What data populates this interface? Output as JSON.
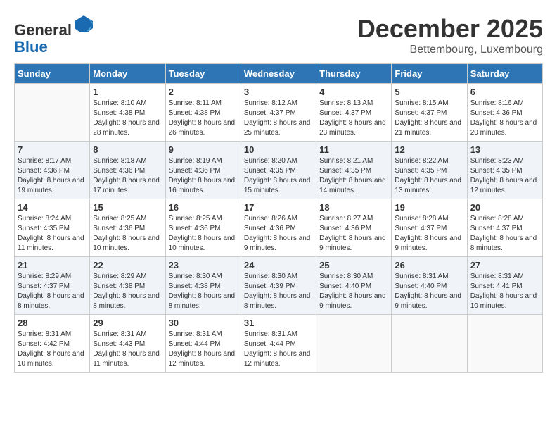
{
  "header": {
    "logo_line1": "General",
    "logo_line2": "Blue",
    "month_title": "December 2025",
    "location": "Bettembourg, Luxembourg"
  },
  "days_of_week": [
    "Sunday",
    "Monday",
    "Tuesday",
    "Wednesday",
    "Thursday",
    "Friday",
    "Saturday"
  ],
  "weeks": [
    [
      {
        "day": "",
        "sunrise": "",
        "sunset": "",
        "daylight": ""
      },
      {
        "day": "1",
        "sunrise": "Sunrise: 8:10 AM",
        "sunset": "Sunset: 4:38 PM",
        "daylight": "Daylight: 8 hours and 28 minutes."
      },
      {
        "day": "2",
        "sunrise": "Sunrise: 8:11 AM",
        "sunset": "Sunset: 4:38 PM",
        "daylight": "Daylight: 8 hours and 26 minutes."
      },
      {
        "day": "3",
        "sunrise": "Sunrise: 8:12 AM",
        "sunset": "Sunset: 4:37 PM",
        "daylight": "Daylight: 8 hours and 25 minutes."
      },
      {
        "day": "4",
        "sunrise": "Sunrise: 8:13 AM",
        "sunset": "Sunset: 4:37 PM",
        "daylight": "Daylight: 8 hours and 23 minutes."
      },
      {
        "day": "5",
        "sunrise": "Sunrise: 8:15 AM",
        "sunset": "Sunset: 4:37 PM",
        "daylight": "Daylight: 8 hours and 21 minutes."
      },
      {
        "day": "6",
        "sunrise": "Sunrise: 8:16 AM",
        "sunset": "Sunset: 4:36 PM",
        "daylight": "Daylight: 8 hours and 20 minutes."
      }
    ],
    [
      {
        "day": "7",
        "sunrise": "Sunrise: 8:17 AM",
        "sunset": "Sunset: 4:36 PM",
        "daylight": "Daylight: 8 hours and 19 minutes."
      },
      {
        "day": "8",
        "sunrise": "Sunrise: 8:18 AM",
        "sunset": "Sunset: 4:36 PM",
        "daylight": "Daylight: 8 hours and 17 minutes."
      },
      {
        "day": "9",
        "sunrise": "Sunrise: 8:19 AM",
        "sunset": "Sunset: 4:36 PM",
        "daylight": "Daylight: 8 hours and 16 minutes."
      },
      {
        "day": "10",
        "sunrise": "Sunrise: 8:20 AM",
        "sunset": "Sunset: 4:35 PM",
        "daylight": "Daylight: 8 hours and 15 minutes."
      },
      {
        "day": "11",
        "sunrise": "Sunrise: 8:21 AM",
        "sunset": "Sunset: 4:35 PM",
        "daylight": "Daylight: 8 hours and 14 minutes."
      },
      {
        "day": "12",
        "sunrise": "Sunrise: 8:22 AM",
        "sunset": "Sunset: 4:35 PM",
        "daylight": "Daylight: 8 hours and 13 minutes."
      },
      {
        "day": "13",
        "sunrise": "Sunrise: 8:23 AM",
        "sunset": "Sunset: 4:35 PM",
        "daylight": "Daylight: 8 hours and 12 minutes."
      }
    ],
    [
      {
        "day": "14",
        "sunrise": "Sunrise: 8:24 AM",
        "sunset": "Sunset: 4:35 PM",
        "daylight": "Daylight: 8 hours and 11 minutes."
      },
      {
        "day": "15",
        "sunrise": "Sunrise: 8:25 AM",
        "sunset": "Sunset: 4:36 PM",
        "daylight": "Daylight: 8 hours and 10 minutes."
      },
      {
        "day": "16",
        "sunrise": "Sunrise: 8:25 AM",
        "sunset": "Sunset: 4:36 PM",
        "daylight": "Daylight: 8 hours and 10 minutes."
      },
      {
        "day": "17",
        "sunrise": "Sunrise: 8:26 AM",
        "sunset": "Sunset: 4:36 PM",
        "daylight": "Daylight: 8 hours and 9 minutes."
      },
      {
        "day": "18",
        "sunrise": "Sunrise: 8:27 AM",
        "sunset": "Sunset: 4:36 PM",
        "daylight": "Daylight: 8 hours and 9 minutes."
      },
      {
        "day": "19",
        "sunrise": "Sunrise: 8:28 AM",
        "sunset": "Sunset: 4:37 PM",
        "daylight": "Daylight: 8 hours and 9 minutes."
      },
      {
        "day": "20",
        "sunrise": "Sunrise: 8:28 AM",
        "sunset": "Sunset: 4:37 PM",
        "daylight": "Daylight: 8 hours and 8 minutes."
      }
    ],
    [
      {
        "day": "21",
        "sunrise": "Sunrise: 8:29 AM",
        "sunset": "Sunset: 4:37 PM",
        "daylight": "Daylight: 8 hours and 8 minutes."
      },
      {
        "day": "22",
        "sunrise": "Sunrise: 8:29 AM",
        "sunset": "Sunset: 4:38 PM",
        "daylight": "Daylight: 8 hours and 8 minutes."
      },
      {
        "day": "23",
        "sunrise": "Sunrise: 8:30 AM",
        "sunset": "Sunset: 4:38 PM",
        "daylight": "Daylight: 8 hours and 8 minutes."
      },
      {
        "day": "24",
        "sunrise": "Sunrise: 8:30 AM",
        "sunset": "Sunset: 4:39 PM",
        "daylight": "Daylight: 8 hours and 8 minutes."
      },
      {
        "day": "25",
        "sunrise": "Sunrise: 8:30 AM",
        "sunset": "Sunset: 4:40 PM",
        "daylight": "Daylight: 8 hours and 9 minutes."
      },
      {
        "day": "26",
        "sunrise": "Sunrise: 8:31 AM",
        "sunset": "Sunset: 4:40 PM",
        "daylight": "Daylight: 8 hours and 9 minutes."
      },
      {
        "day": "27",
        "sunrise": "Sunrise: 8:31 AM",
        "sunset": "Sunset: 4:41 PM",
        "daylight": "Daylight: 8 hours and 10 minutes."
      }
    ],
    [
      {
        "day": "28",
        "sunrise": "Sunrise: 8:31 AM",
        "sunset": "Sunset: 4:42 PM",
        "daylight": "Daylight: 8 hours and 10 minutes."
      },
      {
        "day": "29",
        "sunrise": "Sunrise: 8:31 AM",
        "sunset": "Sunset: 4:43 PM",
        "daylight": "Daylight: 8 hours and 11 minutes."
      },
      {
        "day": "30",
        "sunrise": "Sunrise: 8:31 AM",
        "sunset": "Sunset: 4:44 PM",
        "daylight": "Daylight: 8 hours and 12 minutes."
      },
      {
        "day": "31",
        "sunrise": "Sunrise: 8:31 AM",
        "sunset": "Sunset: 4:44 PM",
        "daylight": "Daylight: 8 hours and 12 minutes."
      },
      {
        "day": "",
        "sunrise": "",
        "sunset": "",
        "daylight": ""
      },
      {
        "day": "",
        "sunrise": "",
        "sunset": "",
        "daylight": ""
      },
      {
        "day": "",
        "sunrise": "",
        "sunset": "",
        "daylight": ""
      }
    ]
  ]
}
